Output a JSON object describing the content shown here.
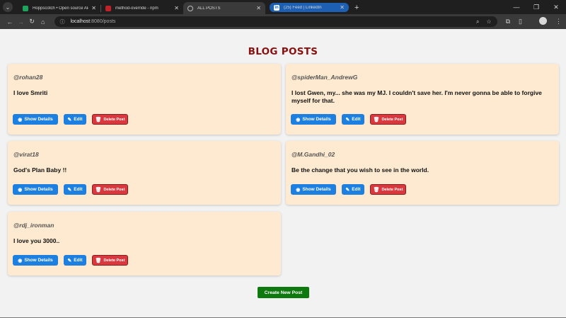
{
  "browser": {
    "tabs": [
      {
        "title": "Hoppscotch • Open source API"
      },
      {
        "title": "method-override - npm"
      },
      {
        "title": "ALL POSTS"
      },
      {
        "title": "(25) Feed | LinkedIn"
      }
    ],
    "url_host": "localhost",
    "url_path": ":8080/posts"
  },
  "page": {
    "title": "BLOG POSTS",
    "create_label": "Create New Post"
  },
  "buttons": {
    "show": "Show Details",
    "edit": "Edit",
    "delete": "Delete Post"
  },
  "posts": [
    {
      "username": "@rohan28",
      "content": "I love Smriti"
    },
    {
      "username": "@spiderMan_AndrewG",
      "content": "I lost Gwen, my... she was my MJ. I couldn't save her. I'm never gonna be able to forgive myself for that."
    },
    {
      "username": "@virat18",
      "content": "God's Plan Baby !!"
    },
    {
      "username": "@M.Gandhi_02",
      "content": "Be the change that you wish to see in the world."
    },
    {
      "username": "@rdj_ironman",
      "content": "I love you 3000.."
    }
  ],
  "colors": {
    "title": "#8b0f0f",
    "card_bg": "#feead0",
    "primary": "#1d7fe0",
    "danger": "#d9393e",
    "success": "#0e7a0e"
  }
}
